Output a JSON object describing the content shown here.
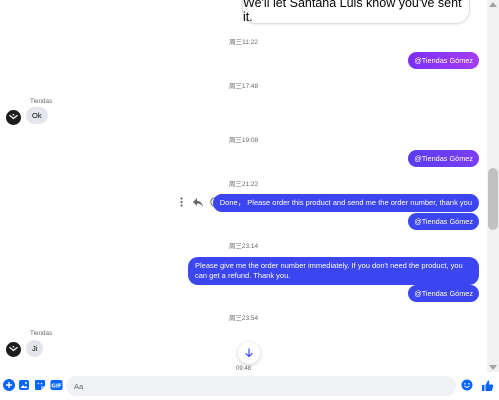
{
  "banner": {
    "text": "We'll let Santana Luis know you've sent it."
  },
  "messages": {
    "ts1": "周三11:22",
    "out1": "@Tiendas Gómez",
    "ts2": "周三17:48",
    "sender1": "Tiendas",
    "in1": "Ok",
    "ts3": "周三19:08",
    "out2": "@Tiendas Gómez",
    "ts4": "周三21:22",
    "out3": "Done， Please order this product and send me the order number, thank you",
    "out4": "@Tiendas Gómez",
    "ts5": "周三23:14",
    "out5": "Please give me the order number immediately. If you don't need the product, you can get a refund. Thank you.",
    "out6": "@Tiendas Gómez",
    "ts6": "周三23:54",
    "sender2": "Tiendas",
    "in2": "Ji",
    "ts7": "09:48"
  },
  "composer": {
    "placeholder": "Aa"
  },
  "colors": {
    "accent": "#0866ff",
    "bubble": "#3c46f0",
    "pill_gradient_start": "#7b2ff7",
    "pill_gradient_end": "#a43df2"
  },
  "icons": [
    "more-icon",
    "reply-icon",
    "emoji-icon",
    "scroll-down-icon",
    "plus-icon",
    "image-icon",
    "sticker-icon",
    "gif-icon",
    "emoji-icon",
    "like-icon"
  ]
}
